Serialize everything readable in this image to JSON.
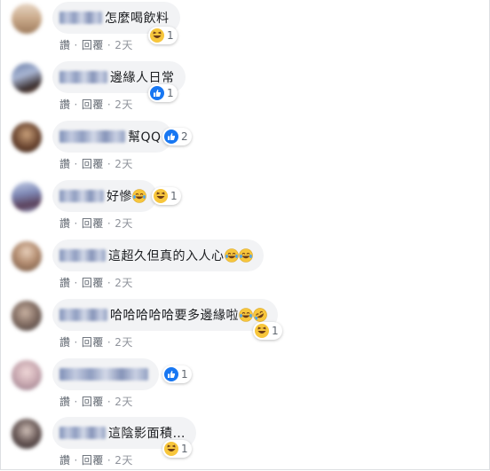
{
  "actions": {
    "like": "讚",
    "reply": "回覆",
    "sep": "·"
  },
  "comments": [
    {
      "text": "怎麼喝飲料",
      "time": "2天",
      "reaction": "haha",
      "count": "1"
    },
    {
      "text": "邊緣人日常",
      "time": "2天",
      "reaction": "like",
      "count": "1"
    },
    {
      "text": "幫QQ",
      "time": "2天",
      "reaction": "like",
      "count": "2"
    },
    {
      "text": "好慘",
      "time": "2天",
      "reaction": "haha",
      "count": "1",
      "inline_emoji": [
        "tears-of-joy"
      ]
    },
    {
      "text": "這超久但真的入人心",
      "time": "2天",
      "reaction": "",
      "count": "",
      "inline_emoji": [
        "tears-of-joy",
        "tears-of-joy"
      ]
    },
    {
      "text": "哈哈哈哈哈要多邊緣啦",
      "time": "2天",
      "reaction": "haha",
      "count": "1",
      "inline_emoji": [
        "tears-of-joy",
        "rofl"
      ]
    },
    {
      "text": "",
      "time": "2天",
      "reaction": "like",
      "count": "1"
    },
    {
      "text": "這陰影面積…",
      "time": "2天",
      "reaction": "haha",
      "count": "1"
    }
  ],
  "colors": {
    "link": "#385898",
    "bubble": "#f2f3f5",
    "like_blue": "#1877f2",
    "haha_yellow": "#f7c63c"
  }
}
